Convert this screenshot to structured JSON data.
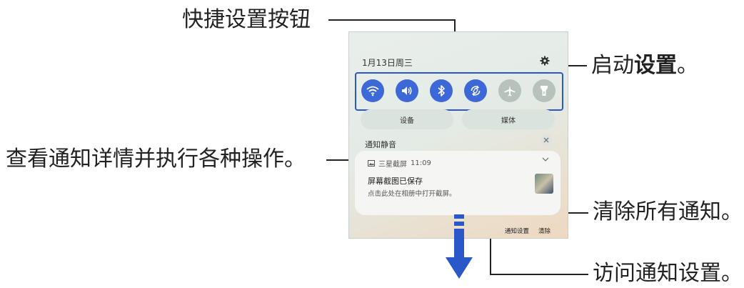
{
  "callouts": {
    "quick_settings": "快捷设置按钮",
    "start_settings_prefix": "启动",
    "start_settings_bold": "设置",
    "start_settings_suffix": "。",
    "view_details": "查看通知详情并执行各种操作。",
    "clear_all": "清除所有通知。",
    "access_settings": "访问通知设置。"
  },
  "panel": {
    "date": "1月13日周三",
    "quick_buttons": [
      {
        "icon": "wifi-icon",
        "state": "on"
      },
      {
        "icon": "sound-icon",
        "state": "on"
      },
      {
        "icon": "bluetooth-icon",
        "state": "on"
      },
      {
        "icon": "auto-rotate-icon",
        "state": "on"
      },
      {
        "icon": "airplane-icon",
        "state": "off"
      },
      {
        "icon": "flashlight-icon",
        "state": "off"
      }
    ],
    "device_label": "设备",
    "media_label": "媒体",
    "silent_label": "通知静音",
    "notification": {
      "app": "三星截屏",
      "time": "11:09",
      "title": "屏幕截图已保存",
      "text": "点击此处在相册中打开截屏。"
    },
    "notification_settings_label": "通知设置",
    "clear_label": "清除"
  },
  "colors": {
    "accent": "#3d68d8",
    "highlight_border": "#2a58c8",
    "arrow": "#2a58c8"
  }
}
